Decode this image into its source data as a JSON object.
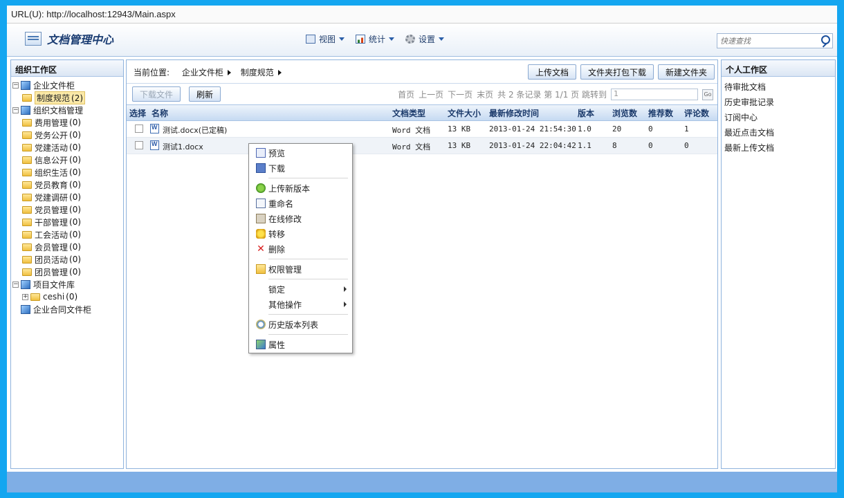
{
  "browser": {
    "url_label": "URL(U):",
    "url": "http://localhost:12943/Main.aspx"
  },
  "header": {
    "app_title": "文档管理中心",
    "menu": [
      {
        "label": "视图"
      },
      {
        "label": "统计"
      },
      {
        "label": "设置"
      }
    ],
    "search_placeholder": "快速查找"
  },
  "left": {
    "title": "组织工作区",
    "tree": {
      "enterprise": "企业文件柜",
      "enterprise_child": {
        "label": "制度规范",
        "count": "(2)"
      },
      "org": "组织文档管理",
      "org_children": [
        {
          "label": "费用管理",
          "count": "(0)"
        },
        {
          "label": "党务公开",
          "count": "(0)"
        },
        {
          "label": "党建活动",
          "count": "(0)"
        },
        {
          "label": "信息公开",
          "count": "(0)"
        },
        {
          "label": "组织生活",
          "count": "(0)"
        },
        {
          "label": "党员教育",
          "count": "(0)"
        },
        {
          "label": "党建调研",
          "count": "(0)"
        },
        {
          "label": "党员管理",
          "count": "(0)"
        },
        {
          "label": "干部管理",
          "count": "(0)"
        },
        {
          "label": "工会活动",
          "count": "(0)"
        },
        {
          "label": "会员管理",
          "count": "(0)"
        },
        {
          "label": "团员活动",
          "count": "(0)"
        },
        {
          "label": "团员管理",
          "count": "(0)"
        }
      ],
      "project": "项目文件库",
      "project_child": {
        "label": "ceshi",
        "count": "(0)"
      },
      "contract": "企业合同文件柜"
    }
  },
  "center": {
    "breadcrumb": {
      "prefix": "当前位置:",
      "level1": "企业文件柜",
      "level2": "制度规范"
    },
    "buttons": {
      "upload": "上传文档",
      "pack_download": "文件夹打包下载",
      "new_folder": "新建文件夹",
      "download": "下载文件",
      "refresh": "刷新"
    },
    "pager": {
      "first": "首页",
      "prev": "上一页",
      "next": "下一页",
      "last": "末页",
      "summary": "共 2 条记录 第 1/1 页 跳转到",
      "jump_value": "1",
      "go": "Go"
    },
    "columns": {
      "select": "选择",
      "name": "名称",
      "type": "文档类型",
      "size": "文件大小",
      "modified": "最新修改时间",
      "version": "版本",
      "views": "浏览数",
      "recommends": "推荐数",
      "comments": "评论数"
    },
    "rows": [
      {
        "name": "测试.docx(已定稿)",
        "type": "Word 文档",
        "size": "13 KB",
        "modified": "2013-01-24 21:54:30",
        "version": "1.0",
        "views": "20",
        "recommends": "0",
        "comments": "1"
      },
      {
        "name": "测试1.docx",
        "type": "Word 文档",
        "size": "13 KB",
        "modified": "2013-01-24 22:04:42",
        "version": "1.1",
        "views": "8",
        "recommends": "0",
        "comments": "0"
      }
    ]
  },
  "context_menu": {
    "preview": "预览",
    "download": "下载",
    "upload_new": "上传新版本",
    "rename": "重命名",
    "online_edit": "在线修改",
    "move": "转移",
    "delete": "删除",
    "permissions": "权限管理",
    "lock": "锁定",
    "other_ops": "其他操作",
    "history": "历史版本列表",
    "properties": "属性"
  },
  "right": {
    "title": "个人工作区",
    "items": [
      "待审批文档",
      "历史审批记录",
      "订阅中心",
      "最近点击文档",
      "最新上传文档"
    ]
  }
}
